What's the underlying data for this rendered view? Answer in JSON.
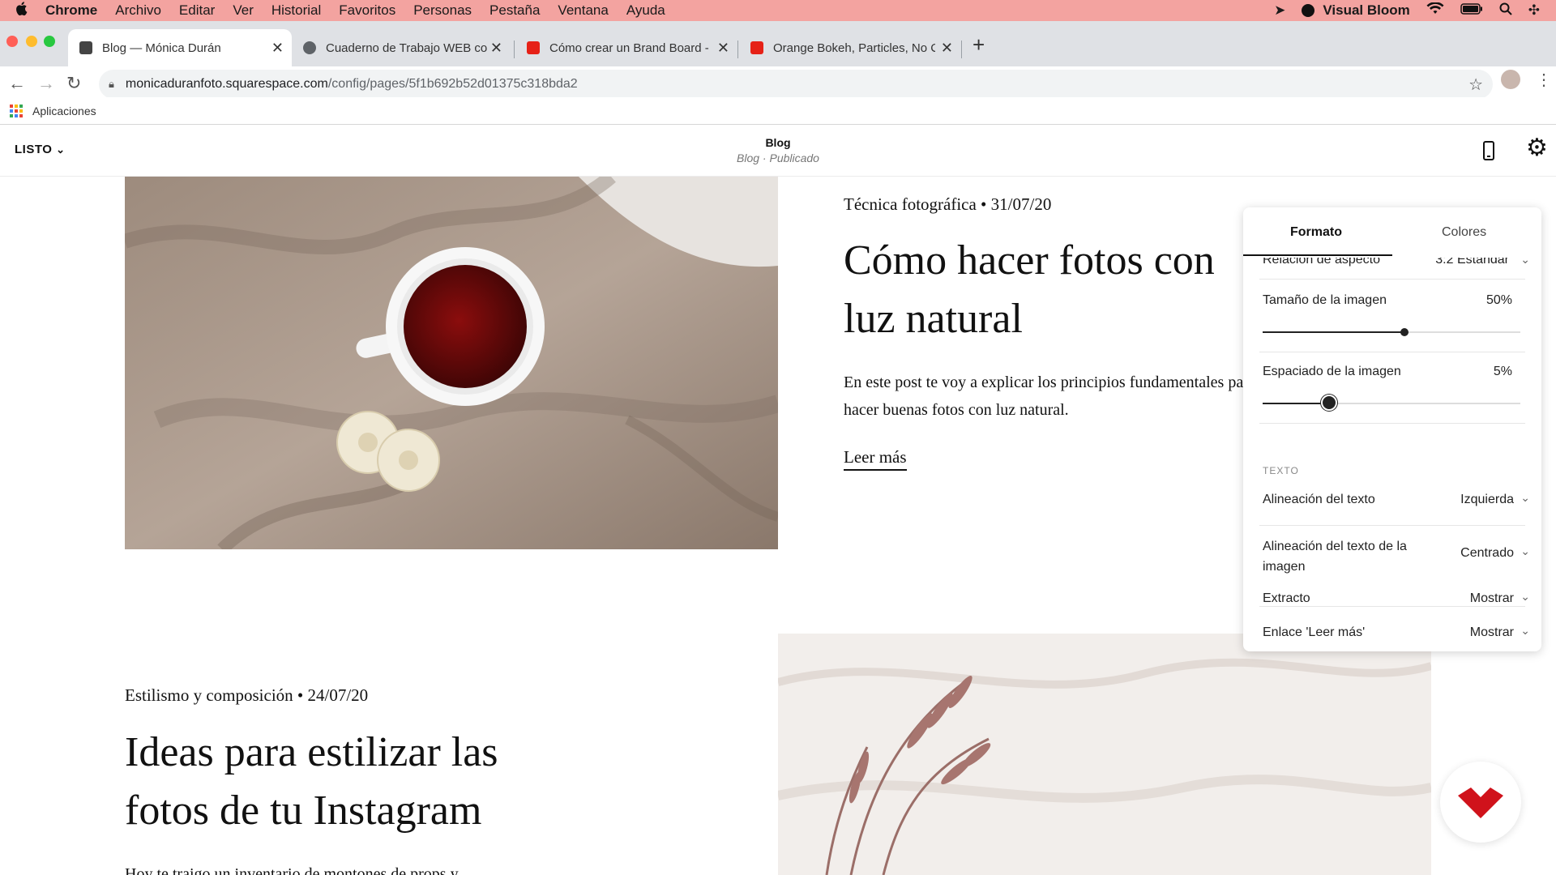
{
  "menubar": {
    "app": "Chrome",
    "items": [
      "Archivo",
      "Editar",
      "Ver",
      "Historial",
      "Favoritos",
      "Personas",
      "Pestaña",
      "Ventana",
      "Ayuda"
    ],
    "status_app": "Visual Bloom"
  },
  "tabs": [
    {
      "title": "Blog — Mónica Durán",
      "favicon": "squarespace-icon",
      "active": true
    },
    {
      "title": "Cuaderno de Trabajo WEB com",
      "favicon": "globe-icon",
      "active": false
    },
    {
      "title": "Cómo crear un Brand Board - Y",
      "favicon": "youtube-icon",
      "active": false
    },
    {
      "title": "Orange Bokeh, Particles, No Co",
      "favicon": "youtube-icon",
      "active": false
    }
  ],
  "url": {
    "host": "monicaduranfoto.squarespace.com",
    "path": "/config/pages/5f1b692b52d01375c318bda2"
  },
  "bookmarks": {
    "apps_label": "Aplicaciones"
  },
  "editor": {
    "done_label": "LISTO",
    "page_title": "Blog",
    "page_subtitle": "Blog · Publicado"
  },
  "posts": [
    {
      "meta": "Técnica fotográfica • 31/07/20",
      "title": "Cómo hacer fotos con luz natural",
      "excerpt": "En este post te voy a explicar los principios fundamentales para hacer buenas fotos con luz natural.",
      "read_more": "Leer más"
    },
    {
      "meta": "Estilismo y composición • 24/07/20",
      "title": "Ideas para estilizar las fotos de tu Instagram",
      "excerpt": "Hoy te traigo un inventario de montones de props y"
    }
  ],
  "panel": {
    "tabs": [
      "Formato",
      "Colores"
    ],
    "active_tab": "Formato",
    "cut_row": {
      "label": "Relación de aspecto",
      "value": "3:2 Estándar"
    },
    "image_size": {
      "label": "Tamaño de la imagen",
      "value": "50%",
      "level": 0.55
    },
    "image_spacing": {
      "label": "Espaciado de la imagen",
      "value": "5%",
      "level": 0.26
    },
    "text_section": "TEXTO",
    "rows": [
      {
        "label": "Alineación del texto",
        "value": "Izquierda"
      },
      {
        "label": "Alineación del texto de la imagen",
        "value": "Centrado"
      },
      {
        "label": "Extracto",
        "value": "Mostrar"
      },
      {
        "label": "Enlace 'Leer más'",
        "value": "Mostrar"
      }
    ]
  },
  "colors": {
    "menubar": "#f3a3a0",
    "logo_red": "#d0121b"
  }
}
